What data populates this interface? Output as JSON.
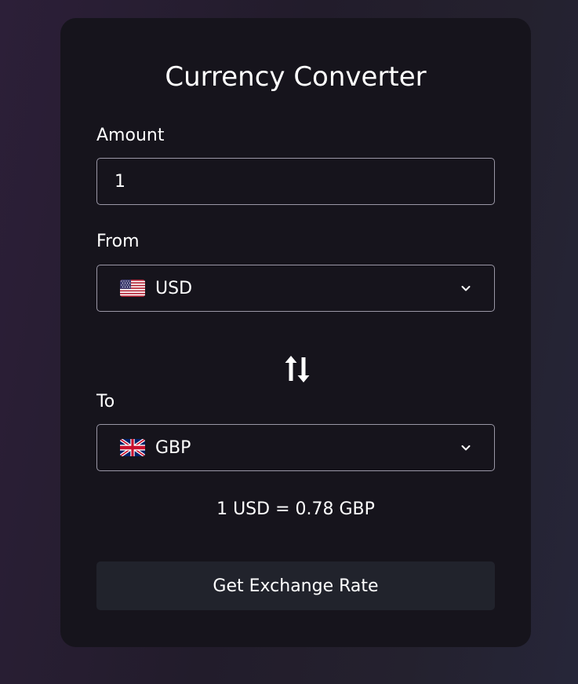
{
  "converter": {
    "title": "Currency Converter",
    "amount": {
      "label": "Amount",
      "value": "1"
    },
    "from": {
      "label": "From",
      "currency": "USD",
      "flag_icon": "us-flag-icon"
    },
    "to": {
      "label": "To",
      "currency": "GBP",
      "flag_icon": "uk-flag-icon"
    },
    "swap_icon": "swap-arrows-icon",
    "result_text": "1 USD = 0.78 GBP",
    "button_label": "Get Exchange Rate"
  },
  "colors": {
    "card_background": "#16141c",
    "button_background": "#21232c",
    "field_border": "#9a97a6",
    "text": "#ffffff"
  }
}
